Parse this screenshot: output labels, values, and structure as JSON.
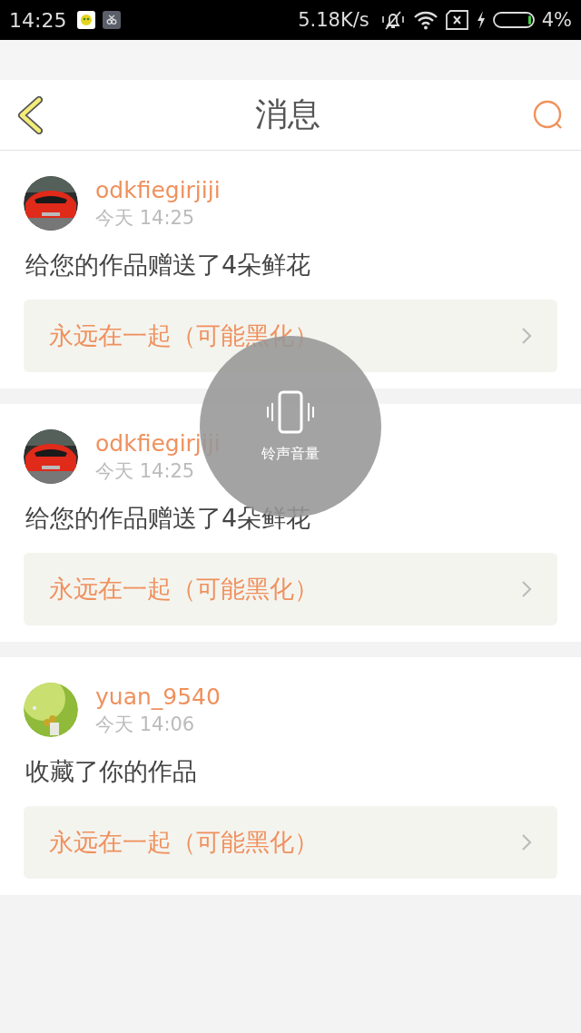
{
  "status_bar": {
    "time": "14:25",
    "speed": "5.18K/s",
    "battery": "4%"
  },
  "header": {
    "title": "消息"
  },
  "messages": [
    {
      "user": "odkfiegirjiji",
      "time": "今天 14:25",
      "text": "给您的作品赠送了4朵鲜花",
      "work": "永远在一起（可能黑化）"
    },
    {
      "user": "odkfiegirjiji",
      "time": "今天 14:25",
      "text": "给您的作品赠送了4朵鲜花",
      "work": "永远在一起（可能黑化）"
    },
    {
      "user": "yuan_9540",
      "time": "今天 14:06",
      "text": "收藏了你的作品",
      "work": "永远在一起（可能黑化）"
    }
  ],
  "volume_toast": {
    "label": "铃声音量"
  }
}
